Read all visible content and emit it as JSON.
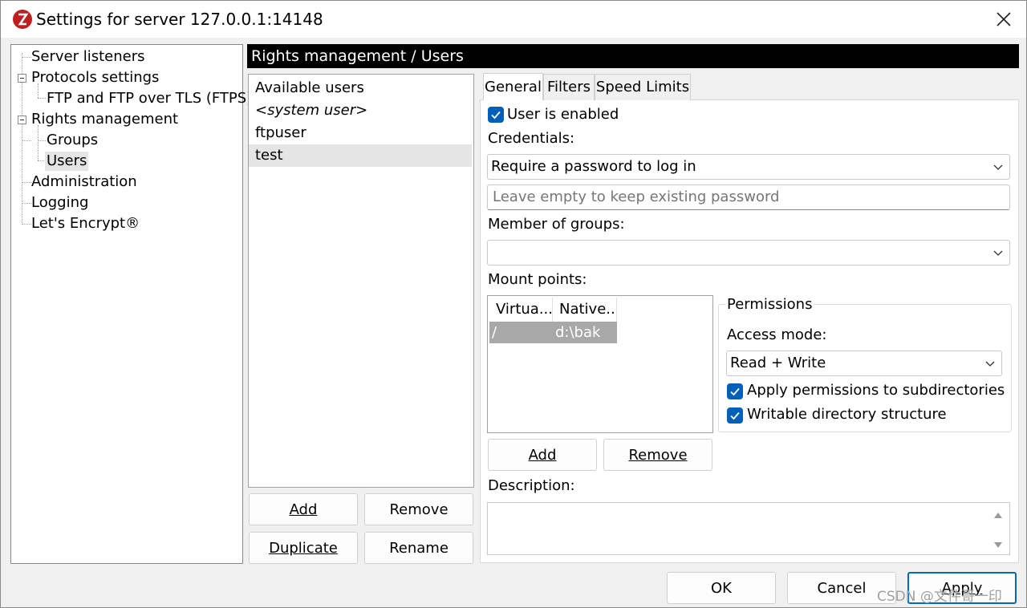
{
  "window": {
    "title": "Settings for server 127.0.0.1:14148"
  },
  "tree": {
    "items": [
      {
        "label": "Server listeners"
      },
      {
        "label": "Protocols settings"
      },
      {
        "label": "FTP and FTP over TLS (FTPS)"
      },
      {
        "label": "Rights management"
      },
      {
        "label": "Groups"
      },
      {
        "label": "Users",
        "selected": true
      },
      {
        "label": "Administration"
      },
      {
        "label": "Logging"
      },
      {
        "label": "Let's Encrypt®"
      }
    ]
  },
  "header": {
    "title": "Rights management / Users"
  },
  "users": {
    "list_header": "Available users",
    "items": [
      {
        "label": "<system user>",
        "italic": true
      },
      {
        "label": "ftpuser"
      },
      {
        "label": "test",
        "selected": true
      }
    ],
    "buttons": {
      "add": "Add",
      "remove": "Remove",
      "duplicate": "Duplicate",
      "rename": "Rename"
    }
  },
  "tabs": [
    {
      "label": "General",
      "active": true
    },
    {
      "label": "Filters"
    },
    {
      "label": "Speed Limits"
    }
  ],
  "general": {
    "user_enabled_label": "User is enabled",
    "user_enabled": true,
    "credentials_label": "Credentials:",
    "credentials_value": "Require a password to log in",
    "password_placeholder": "Leave empty to keep existing password",
    "groups_label": "Member of groups:",
    "groups_value": "",
    "mount_points_label": "Mount points:",
    "mount_columns": [
      "Virtua...",
      "Native..."
    ],
    "mount_rows": [
      {
        "virtual": "/",
        "native": "d:\\bak"
      }
    ],
    "mount_add": "Add",
    "mount_remove": "Remove",
    "permissions": {
      "title": "Permissions",
      "access_mode_label": "Access mode:",
      "access_mode_value": "Read + Write",
      "apply_subdirs_label": "Apply permissions to subdirectories",
      "apply_subdirs": true,
      "writable_structure_label": "Writable directory structure",
      "writable_structure": true
    },
    "description_label": "Description:",
    "description_value": ""
  },
  "footer": {
    "ok": "OK",
    "cancel": "Cancel",
    "apply": "Apply"
  },
  "watermark": "CSDN @文件哥一印",
  "colors": {
    "accent": "#005fb8",
    "header_bg": "#000000",
    "selection": "#e5e5e5",
    "mount_selection": "#a8a8a8"
  }
}
